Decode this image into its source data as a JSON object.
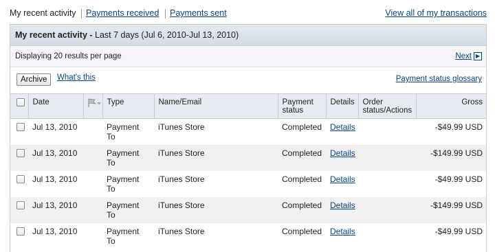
{
  "topnav": {
    "current": "My recent activity",
    "payments_received": "Payments received",
    "payments_sent": "Payments sent",
    "view_all": "View all of my transactions"
  },
  "panel": {
    "title_bold": "My recent activity -",
    "title_range": " Last 7 days (Jul 6, 2010-Jul 13, 2010)",
    "displaying": "Displaying 20 results per page",
    "next": "Next",
    "archive_label": "Archive",
    "whats_this": "What's this",
    "glossary": "Payment status glossary"
  },
  "columns": {
    "date": "Date",
    "flag_icon": "flag-icon",
    "type": "Type",
    "name": "Name/Email",
    "payment_status_1": "Payment",
    "payment_status_2": "status",
    "details": "Details",
    "order_1": "Order",
    "order_2": "status/Actions",
    "gross": "Gross"
  },
  "rows": [
    {
      "date": "Jul 13, 2010",
      "type1": "Payment",
      "type2": "To",
      "name": "iTunes Store",
      "status": "Completed",
      "details": "Details",
      "gross": "-$49.99 USD"
    },
    {
      "date": "Jul 13, 2010",
      "type1": "Payment",
      "type2": "To",
      "name": "iTunes Store",
      "status": "Completed",
      "details": "Details",
      "gross": "-$149.99 USD"
    },
    {
      "date": "Jul 13, 2010",
      "type1": "Payment",
      "type2": "To",
      "name": "iTunes Store",
      "status": "Completed",
      "details": "Details",
      "gross": "-$49.99 USD"
    },
    {
      "date": "Jul 13, 2010",
      "type1": "Payment",
      "type2": "To",
      "name": "iTunes Store",
      "status": "Completed",
      "details": "Details",
      "gross": "-$149.99 USD"
    },
    {
      "date": "Jul 13, 2010",
      "type1": "Payment",
      "type2": "To",
      "name": "iTunes Store",
      "status": "Completed",
      "details": "Details",
      "gross": "-$49.99 USD"
    }
  ],
  "colors": {
    "link": "#084482",
    "header_bg": "#e6ebf2",
    "alt_row_bg": "#f0f0f0"
  }
}
